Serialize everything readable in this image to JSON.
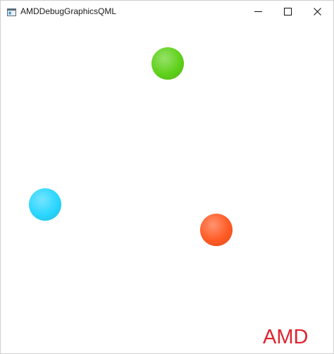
{
  "window": {
    "title": "AMDDebugGraphicsQML",
    "app_icon": "window-app-icon",
    "controls": {
      "minimize_icon": "minimize-icon",
      "maximize_icon": "maximize-icon",
      "close_icon": "close-icon"
    }
  },
  "scene": {
    "balls": [
      {
        "name": "green-ball",
        "color": "#5fd11a"
      },
      {
        "name": "cyan-ball",
        "color": "#2ad6ff"
      },
      {
        "name": "orange-ball",
        "color": "#ff5a24"
      }
    ],
    "label": {
      "text": "AMD",
      "color": "#e0242f"
    }
  }
}
